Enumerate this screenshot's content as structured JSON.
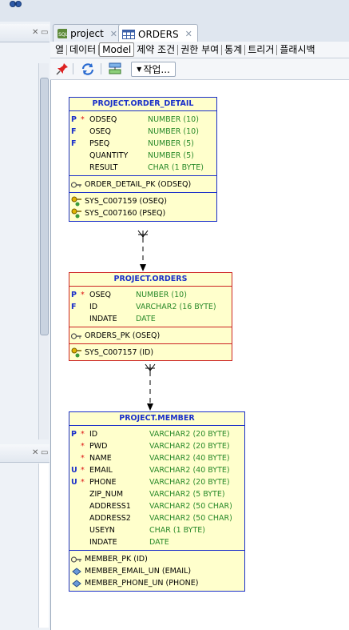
{
  "editor_tabs": [
    {
      "label": "project",
      "icon": "sql-worksheet-icon",
      "active": false
    },
    {
      "label": "ORDERS",
      "icon": "table-icon",
      "active": true
    }
  ],
  "subtabs": [
    "열",
    "데이터",
    "Model",
    "제약 조건",
    "권한 부여",
    "통계",
    "트리거",
    "플래시백"
  ],
  "selected_subtab": "Model",
  "toolbar": {
    "action_label": "작업..."
  },
  "tables": {
    "order_detail": {
      "title": "PROJECT.ORDER_DETAIL",
      "columns": [
        {
          "flag": "P",
          "req": "*",
          "name": "ODSEQ",
          "type": "NUMBER (10)"
        },
        {
          "flag": "F",
          "req": "",
          "name": "OSEQ",
          "type": "NUMBER (10)"
        },
        {
          "flag": "F",
          "req": "",
          "name": "PSEQ",
          "type": "NUMBER (5)"
        },
        {
          "flag": "",
          "req": "",
          "name": "QUANTITY",
          "type": "NUMBER (5)"
        },
        {
          "flag": "",
          "req": "",
          "name": "RESULT",
          "type": "CHAR (1 BYTE)"
        }
      ],
      "primary_keys": [
        "ORDER_DETAIL_PK (ODSEQ)"
      ],
      "foreign_keys": [
        "SYS_C007159 (OSEQ)",
        "SYS_C007160 (PSEQ)"
      ]
    },
    "orders": {
      "title": "PROJECT.ORDERS",
      "columns": [
        {
          "flag": "P",
          "req": "*",
          "name": "OSEQ",
          "type": "NUMBER (10)"
        },
        {
          "flag": "F",
          "req": "",
          "name": "ID",
          "type": "VARCHAR2 (16 BYTE)"
        },
        {
          "flag": "",
          "req": "",
          "name": "INDATE",
          "type": "DATE"
        }
      ],
      "primary_keys": [
        "ORDERS_PK (OSEQ)"
      ],
      "foreign_keys": [
        "SYS_C007157 (ID)"
      ]
    },
    "member": {
      "title": "PROJECT.MEMBER",
      "columns": [
        {
          "flag": "P",
          "req": "*",
          "name": "ID",
          "type": "VARCHAR2 (20 BYTE)"
        },
        {
          "flag": "",
          "req": "*",
          "name": "PWD",
          "type": "VARCHAR2 (20 BYTE)"
        },
        {
          "flag": "",
          "req": "*",
          "name": "NAME",
          "type": "VARCHAR2 (40 BYTE)"
        },
        {
          "flag": "U",
          "req": "*",
          "name": "EMAIL",
          "type": "VARCHAR2 (40 BYTE)"
        },
        {
          "flag": "U",
          "req": "*",
          "name": "PHONE",
          "type": "VARCHAR2 (20 BYTE)"
        },
        {
          "flag": "",
          "req": "",
          "name": "ZIP_NUM",
          "type": "VARCHAR2 (5 BYTE)"
        },
        {
          "flag": "",
          "req": "",
          "name": "ADDRESS1",
          "type": "VARCHAR2 (50 CHAR)"
        },
        {
          "flag": "",
          "req": "",
          "name": "ADDRESS2",
          "type": "VARCHAR2 (50 CHAR)"
        },
        {
          "flag": "",
          "req": "",
          "name": "USEYN",
          "type": "CHAR (1 BYTE)"
        },
        {
          "flag": "",
          "req": "",
          "name": "INDATE",
          "type": "DATE"
        }
      ],
      "primary_keys": [
        "MEMBER_PK (ID)"
      ],
      "unique_keys": [
        "MEMBER_EMAIL_UN (EMAIL)",
        "MEMBER_PHONE_UN (PHONE)"
      ]
    }
  },
  "colors": {
    "title_blue": "#1a2fc9",
    "type_green": "#2a8a2a",
    "required_red": "#dd1111",
    "table_fill": "#ffffcc",
    "selected_border": "#cc2222"
  }
}
